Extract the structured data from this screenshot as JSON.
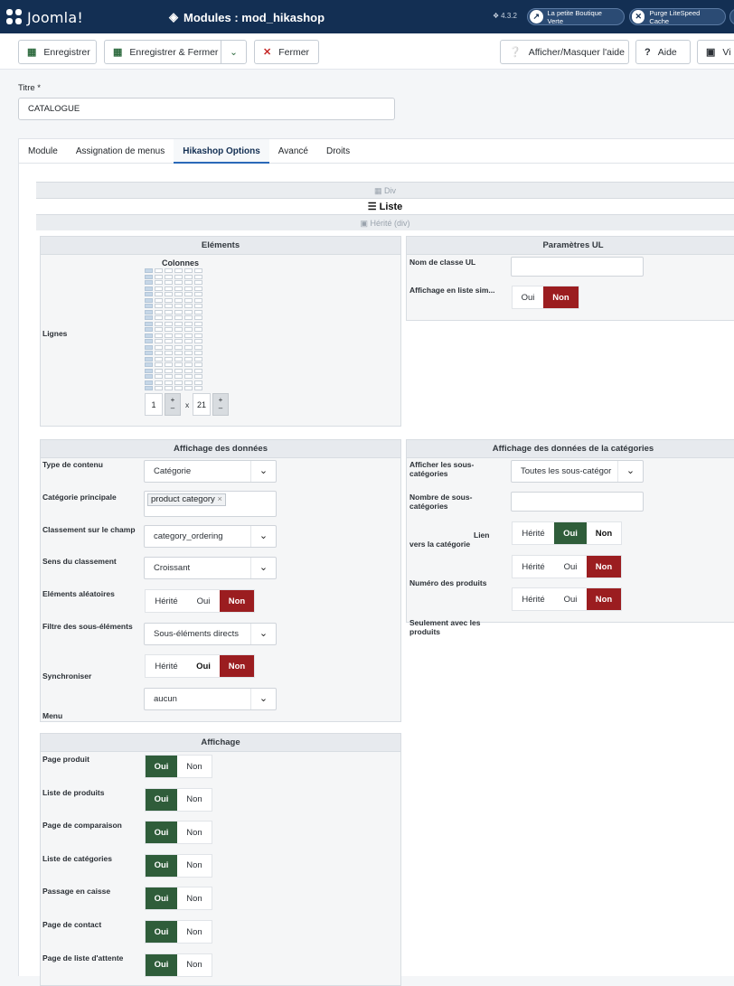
{
  "header": {
    "logo_text": "Joomla!",
    "title": "Modules : mod_hikashop",
    "version": "4.3.2",
    "pill1": "La petite Boutique Verte",
    "pill2": "Purge LiteSpeed Cache"
  },
  "toolbar": {
    "save": "Enregistrer",
    "save_close": "Enregistrer & Fermer",
    "close": "Fermer",
    "toggle_help": "Afficher/Masquer l'aide",
    "help": "Aide",
    "view": "Vi"
  },
  "title_field": {
    "label": "Titre *",
    "value": "CATALOGUE"
  },
  "tabs": [
    "Module",
    "Assignation de menus",
    "Hikashop Options",
    "Avancé",
    "Droits"
  ],
  "layout": {
    "div": "Div",
    "list": "Liste",
    "inherit": "Hérité (div)"
  },
  "elements": {
    "title": "Eléments",
    "columns": "Colonnes",
    "rows": "Lignes",
    "cols_value": "1",
    "times": "x",
    "rows_value": "21"
  },
  "ul_params": {
    "title": "Paramètres UL",
    "class_label": "Nom de classe UL",
    "simple_list_label": "Affichage en liste sim...",
    "yes": "Oui",
    "no": "Non"
  },
  "data_display": {
    "title": "Affichage des données",
    "content_type_label": "Type de contenu",
    "content_type_value": "Catégorie",
    "main_category_label": "Catégorie principale",
    "main_category_chip": "product category",
    "sort_field_label": "Classement sur le champ",
    "sort_field_value": "category_ordering",
    "sort_dir_label": "Sens du classement",
    "sort_dir_value": "Croissant",
    "random_label": "Eléments aléatoires",
    "filter_label": "Filtre des sous-éléments",
    "filter_value": "Sous-éléments directs",
    "sync_label": "Synchroniser",
    "menu_label": "Menu",
    "menu_value": "aucun",
    "inherited": "Hérité",
    "yes": "Oui",
    "no": "Non"
  },
  "category_display": {
    "title": "Affichage des données de la catégories",
    "show_sub_label": "Afficher les sous-catégories",
    "show_sub_value": "Toutes les sous-catégor",
    "num_sub_label": "Nombre de sous-catégories",
    "link_label_1": "Lien",
    "link_label_2": "vers la catégorie",
    "product_number_label": "Numéro des produits",
    "only_with_products_label": "Seulement avec les produits",
    "inherited": "Hérité",
    "yes": "Oui",
    "no": "Non"
  },
  "affichage": {
    "title": "Affichage",
    "rows": [
      "Page produit",
      "Liste de produits",
      "Page de comparaison",
      "Liste de catégories",
      "Passage en caisse",
      "Page de contact",
      "Page de liste d'attente"
    ],
    "yes": "Oui",
    "no": "Non"
  },
  "colors": {
    "header_bg": "#132f53",
    "active_red": "#9b1d20",
    "active_green": "#2f5d3a"
  }
}
